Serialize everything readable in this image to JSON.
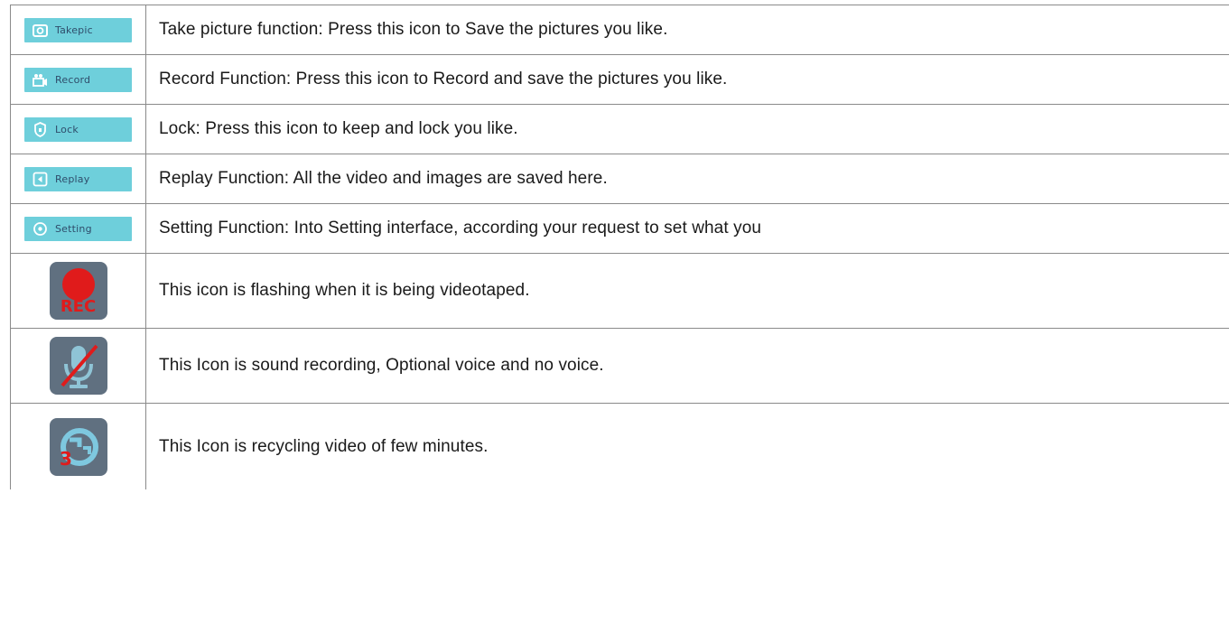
{
  "colors": {
    "button_bg": "#6ecfdb",
    "button_text": "#2f4d6b",
    "icon_tile_bg": "#607080",
    "rec_red": "#e01b1b",
    "border": "#8a8a8a"
  },
  "rows": [
    {
      "icon": "camera-icon",
      "button_label": "Takepic",
      "description": "Take picture function: Press this icon to Save the pictures you like."
    },
    {
      "icon": "video-camera-icon",
      "button_label": "Record",
      "description": "Record Function: Press this icon to Record and save the pictures you like."
    },
    {
      "icon": "lock-icon",
      "button_label": "Lock",
      "description": "Lock: Press this icon to keep and lock you like."
    },
    {
      "icon": "replay-icon",
      "button_label": "Replay",
      "description": "Replay Function: All the video and images are saved here."
    },
    {
      "icon": "gear-icon",
      "button_label": "Setting",
      "description": "Setting Function: Into Setting interface, according your request to set what you"
    },
    {
      "icon": "rec-indicator-icon",
      "icon_label": "REC",
      "description": "This icon is flashing when it is being videotaped."
    },
    {
      "icon": "microphone-muted-icon",
      "description": "This Icon is sound recording, Optional voice and no voice."
    },
    {
      "icon": "loop-recording-icon",
      "icon_label": "3",
      "description": "This Icon is recycling video of few minutes."
    }
  ]
}
